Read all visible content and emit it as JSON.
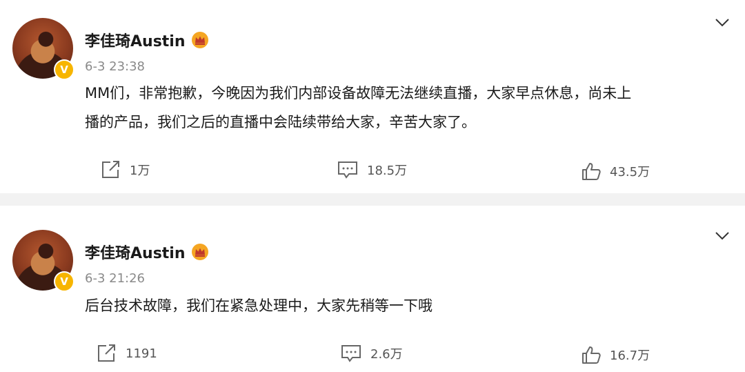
{
  "posts": [
    {
      "author": "李佳琦Austin",
      "time": "6-3 23:38",
      "content_line1": "MM们，非常抱歉，今晚因为我们内部设备故障无法继续直播，大家早点休息，尚未上",
      "content_line2": "播的产品，我们之后的直播中会陆续带给大家，辛苦大家了。",
      "reposts": "1万",
      "comments": "18.5万",
      "likes": "43.5万"
    },
    {
      "author": "李佳琦Austin",
      "time": "6-3 21:26",
      "content_line1": "后台技术故障，我们在紧急处理中，大家先稍等一下哦",
      "reposts": "1191",
      "comments": "2.6万",
      "likes": "16.7万"
    }
  ],
  "icons": {
    "verified": "verified-v-badge",
    "crown": "crown-icon",
    "menu": "chevron-down-icon",
    "repost": "repost-icon",
    "comment": "comment-icon",
    "like": "thumbs-up-icon"
  },
  "colors": {
    "verified_badge": "#f7b500",
    "crown": "#f5a623",
    "divider": "#f2f2f2",
    "meta_text": "#8a8a8a"
  },
  "badge_letter": "V"
}
